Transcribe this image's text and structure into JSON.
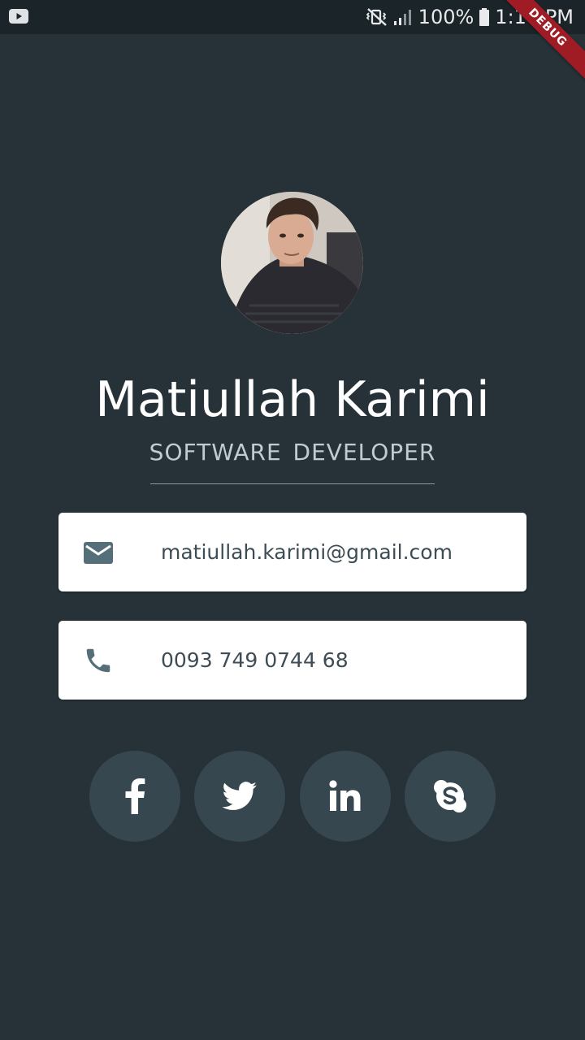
{
  "status_bar": {
    "battery_text": "100%",
    "time": "1:10 PM",
    "icons": [
      "youtube-icon",
      "mute-vibrate-icon",
      "signal-icon",
      "battery-icon"
    ]
  },
  "debug_banner": "DEBUG",
  "profile": {
    "name": "Matiullah Karimi",
    "title": "SOFTWARE DEVELOPER"
  },
  "contacts": {
    "email": "matiullah.karimi@gmail.com",
    "phone": "0093 749 0744 68"
  },
  "socials": [
    {
      "icon": "facebook-icon"
    },
    {
      "icon": "twitter-icon"
    },
    {
      "icon": "linkedin-icon"
    },
    {
      "icon": "skype-icon"
    }
  ],
  "colors": {
    "background": "#263238",
    "status_bar": "#1b2429",
    "card": "#ffffff",
    "icon": "#546e7a",
    "social_button": "#37474f",
    "debug_ribbon": "#a01c24"
  }
}
